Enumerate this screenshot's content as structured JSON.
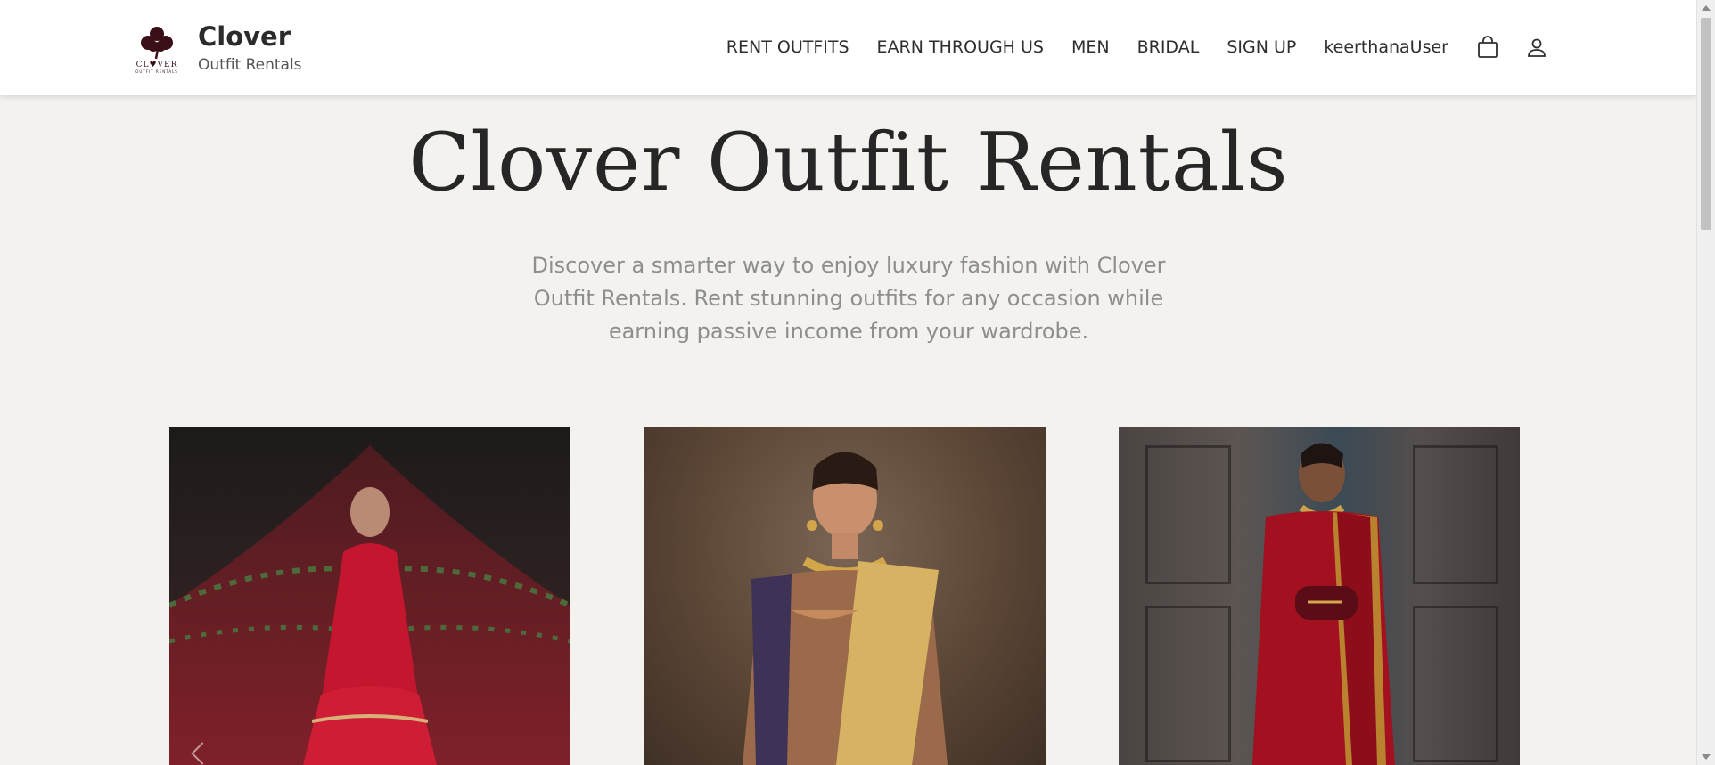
{
  "brand": {
    "name": "Clover",
    "subtitle": "Outfit Rentals",
    "logo_text": "CL♥VER",
    "logo_subtext": "OUTFIT RENTALS",
    "logo_color": "#3a0f18"
  },
  "nav": {
    "links": [
      "RENT OUTFITS",
      "EARN THROUGH US",
      "MEN",
      "BRIDAL",
      "SIGN UP",
      "keerthanaUser"
    ],
    "cart_icon": "shopping-bag-icon",
    "profile_icon": "user-icon"
  },
  "hero": {
    "title": "Clover Outfit Rentals",
    "description": "Discover a smarter way to enjoy luxury fashion with Clover Outfit Rentals. Rent stunning outfits for any occasion while earning passive income from your wardrobe."
  },
  "gallery": {
    "images": [
      {
        "subject": "bride-in-red-lehenga-with-veil",
        "dominant_color": "#b0152a"
      },
      {
        "subject": "woman-in-gold-embroidered-saree",
        "dominant_color": "#c8a25a"
      },
      {
        "subject": "woman-in-red-silk-saree-with-clutch",
        "dominant_color": "#a3101f"
      }
    ],
    "carousel_icon": "chevron-left-icon"
  },
  "colors": {
    "background": "#f4f2ef",
    "navbar": "#ffffff",
    "title": "#262626",
    "muted_text": "#8e8e8e"
  }
}
